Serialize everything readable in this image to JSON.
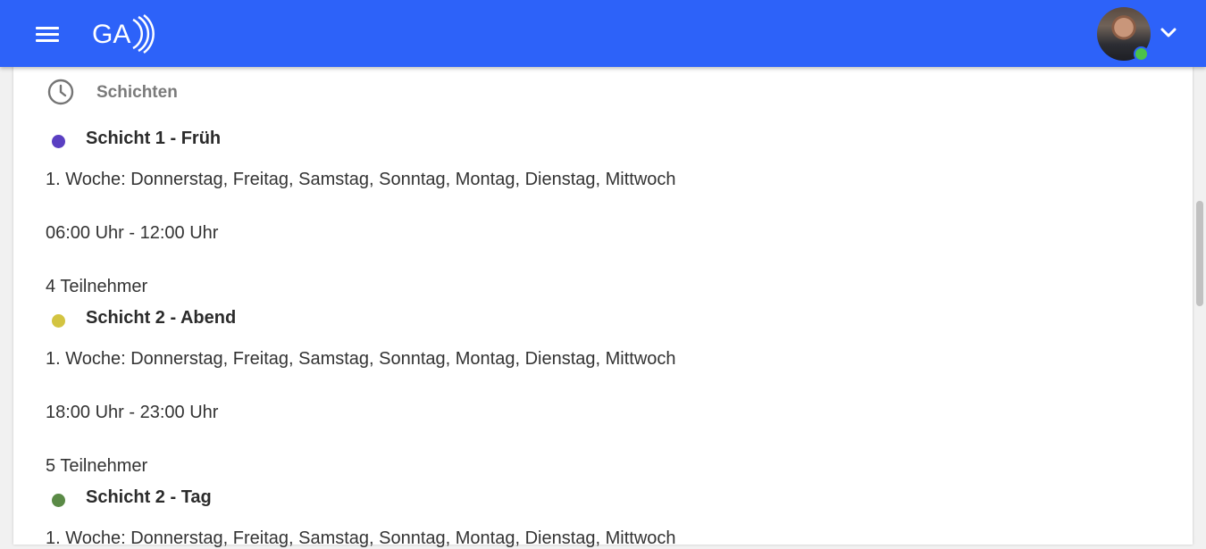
{
  "header": {
    "menu_icon": "hamburger-menu-icon",
    "logo_text": "GA",
    "profile_status_color": "#4cc24a",
    "profile_menu_icon": "chevron-down-icon"
  },
  "colors": {
    "topbar": "#2d62f9",
    "card_bg": "#ffffff"
  },
  "section": {
    "icon": "clock-icon",
    "title": "Schichten"
  },
  "shifts": [
    {
      "name": "Schicht 1 - Früh",
      "color": "#5a3fc2",
      "days": "1. Woche: Donnerstag, Freitag, Samstag, Sonntag, Montag, Dienstag, Mittwoch",
      "time": "06:00 Uhr - 12:00 Uhr",
      "participants": "4 Teilnehmer"
    },
    {
      "name": "Schicht 2 - Abend",
      "color": "#d3c441",
      "days": "1. Woche: Donnerstag, Freitag, Samstag, Sonntag, Montag, Dienstag, Mittwoch",
      "time": "18:00 Uhr - 23:00 Uhr",
      "participants": "5 Teilnehmer"
    },
    {
      "name": "Schicht 2 - Tag",
      "color": "#5a8a46",
      "days": "1. Woche: Donnerstag, Freitag, Samstag, Sonntag, Montag, Dienstag, Mittwoch"
    }
  ]
}
